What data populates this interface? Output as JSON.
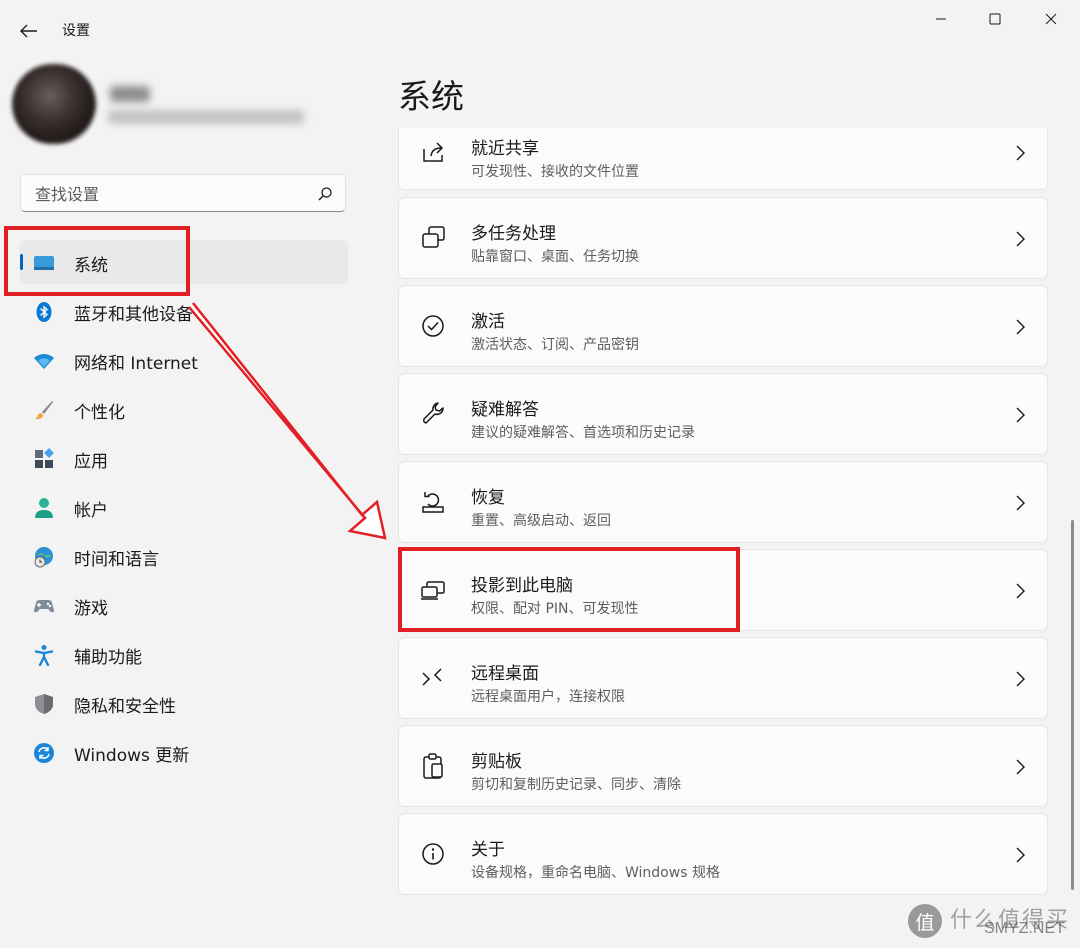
{
  "window": {
    "title": "设置",
    "back_icon": "arrow-left-icon",
    "controls": [
      "minimize-icon",
      "maximize-icon",
      "close-icon"
    ]
  },
  "search": {
    "placeholder": "查找设置",
    "value": "",
    "icon": "search-icon"
  },
  "sidebar": {
    "items": [
      {
        "label": "系统",
        "icon": "monitor-icon",
        "selected": true
      },
      {
        "label": "蓝牙和其他设备",
        "icon": "bluetooth-icon"
      },
      {
        "label": "网络和 Internet",
        "icon": "wifi-icon"
      },
      {
        "label": "个性化",
        "icon": "brush-icon"
      },
      {
        "label": "应用",
        "icon": "apps-icon"
      },
      {
        "label": "帐户",
        "icon": "person-icon"
      },
      {
        "label": "时间和语言",
        "icon": "globe-clock-icon"
      },
      {
        "label": "游戏",
        "icon": "gamepad-icon"
      },
      {
        "label": "辅助功能",
        "icon": "accessibility-icon"
      },
      {
        "label": "隐私和安全性",
        "icon": "shield-icon"
      },
      {
        "label": "Windows 更新",
        "icon": "update-icon"
      }
    ]
  },
  "main": {
    "title": "系统",
    "cards": [
      {
        "title": "就近共享",
        "subtitle": "可发现性、接收的文件位置",
        "icon": "share-icon"
      },
      {
        "title": "多任务处理",
        "subtitle": "贴靠窗口、桌面、任务切换",
        "icon": "multitask-icon"
      },
      {
        "title": "激活",
        "subtitle": "激活状态、订阅、产品密钥",
        "icon": "check-circle-icon"
      },
      {
        "title": "疑难解答",
        "subtitle": "建议的疑难解答、首选项和历史记录",
        "icon": "wrench-icon"
      },
      {
        "title": "恢复",
        "subtitle": "重置、高级启动、返回",
        "icon": "recovery-icon"
      },
      {
        "title": "投影到此电脑",
        "subtitle": "权限、配对 PIN、可发现性",
        "icon": "project-icon"
      },
      {
        "title": "远程桌面",
        "subtitle": "远程桌面用户，连接权限",
        "icon": "remote-desktop-icon"
      },
      {
        "title": "剪贴板",
        "subtitle": "剪切和复制历史记录、同步、清除",
        "icon": "clipboard-icon"
      },
      {
        "title": "关于",
        "subtitle": "设备规格，重命名电脑、Windows 规格",
        "icon": "info-icon"
      }
    ]
  },
  "annotation": {
    "color": "#e31f26"
  },
  "watermark": {
    "logo": "值",
    "text": "什么值得买",
    "domain": "SMYZ.NET"
  },
  "colors": {
    "accent": "#0067c0",
    "background": "#f3f3f3",
    "card": "#fbfbfb"
  }
}
